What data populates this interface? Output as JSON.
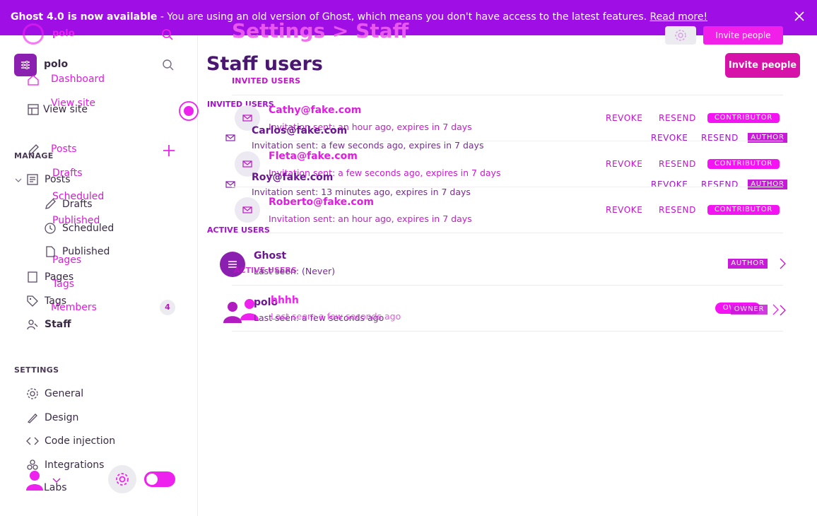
{
  "banner": {
    "version_bold": "Ghost 4.0 is now available",
    "message": " - You are using an old version of Ghost, which means you don't have access to the latest features. ",
    "link": "Read more!"
  },
  "ghost_header": {
    "site_name": "polo",
    "breadcrumb": "Settings > Staff",
    "invite_label": "Invite people"
  },
  "sidebar": {
    "site_name": "polo",
    "ghost_nav": {
      "dashboard": "Dashboard",
      "view_site": "View site",
      "posts": "Posts",
      "drafts": "Drafts",
      "scheduled": "Scheduled",
      "published": "Published",
      "pages": "Pages",
      "tags": "Tags",
      "members": "Members",
      "members_count": "4"
    },
    "view_site": "View site",
    "manage_label": "MANAGE",
    "posts": "Posts",
    "drafts": "Drafts",
    "scheduled": "Scheduled",
    "published": "Published",
    "pages": "Pages",
    "tags": "Tags",
    "staff": "Staff",
    "settings_label": "SETTINGS",
    "settings_items": [
      "General",
      "Design",
      "Code injection",
      "Integrations",
      "Labs"
    ]
  },
  "page": {
    "title": "Staff users",
    "invite_button": "Invite people",
    "invited_label": "INVITED USERS",
    "invited_label_ghost": "INVITED USERS",
    "active_label": "ACTIVE USERS",
    "active_label_ghost": "ACTIVE USERS"
  },
  "invites": [
    {
      "email": "Cathy@fake.com",
      "meta": "Invitation sent: an hour ago, expires in 7 days",
      "revoke": "REVOKE",
      "resend": "RESEND",
      "role": "CONTRIBUTOR"
    },
    {
      "email": "Carlos@fake.com",
      "meta": "Invitation sent: a few seconds ago, expires in 7 days",
      "revoke": "REVOKE",
      "resend": "RESEND",
      "role": "AUTHOR"
    },
    {
      "email": "Fleta@fake.com",
      "meta": "Invitation sent: a few seconds ago, expires in 7 days",
      "revoke": "REVOKE",
      "resend": "RESEND",
      "role": "CONTRIBUTOR"
    },
    {
      "email": "Roy@fake.com",
      "meta": "Invitation sent: 13 minutes ago, expires in 7 days",
      "revoke": "REVOKE",
      "resend": "RESEND",
      "role": "AUTHOR"
    },
    {
      "email": "Roberto@fake.com",
      "meta": "Invitation sent: an hour ago, expires in 7 days",
      "revoke": "REVOKE",
      "resend": "RESEND",
      "role": "CONTRIBUTOR"
    }
  ],
  "active": [
    {
      "name": "Ghost",
      "meta": "Last seen: (Never)",
      "role": "AUTHOR"
    },
    {
      "name": "polo",
      "name_ghost": "hhhh",
      "meta": "Last seen: a few seconds ago",
      "meta_ghost": "Last seen: a few seconds ago",
      "role": "OWNER",
      "role_ghost": "OWNER"
    }
  ],
  "colors": {
    "banner": "#a00ee6",
    "accent": "#e21be2",
    "primary_button": "#d612a8",
    "title": "#4a1770"
  }
}
